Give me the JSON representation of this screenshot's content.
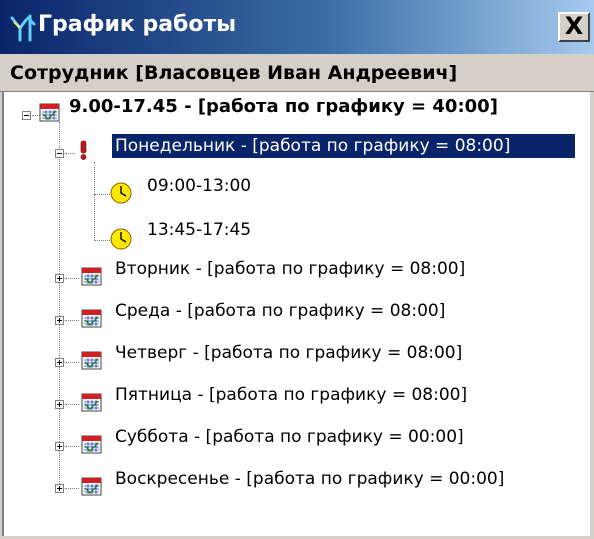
{
  "window": {
    "title": "График работы",
    "close_label": "X",
    "icon": "schedule-app-icon"
  },
  "header": {
    "employee_label": "Сотрудник [Власовцев Иван Андреевич]"
  },
  "tree": {
    "root": {
      "label": "9.00-17.45 - [работа по графику = 40:00]",
      "expanded": true,
      "icon": "calendar-icon"
    },
    "days": [
      {
        "label": "Понедельник - [работа по графику = 08:00]",
        "expanded": true,
        "selected": true,
        "icon": "exclamation-icon",
        "intervals": [
          {
            "label": "09:00-13:00",
            "icon": "clock-icon"
          },
          {
            "label": "13:45-17:45",
            "icon": "clock-icon"
          }
        ]
      },
      {
        "label": "Вторник - [работа по графику = 08:00]",
        "expanded": false,
        "icon": "calendar-icon"
      },
      {
        "label": "Среда - [работа по графику = 08:00]",
        "expanded": false,
        "icon": "calendar-icon"
      },
      {
        "label": "Четверг - [работа по графику = 08:00]",
        "expanded": false,
        "icon": "calendar-icon"
      },
      {
        "label": "Пятница - [работа по графику = 08:00]",
        "expanded": false,
        "icon": "calendar-icon"
      },
      {
        "label": "Суббота - [работа по графику = 00:00]",
        "expanded": false,
        "icon": "calendar-icon"
      },
      {
        "label": "Воскресенье - [работа по графику = 00:00]",
        "expanded": false,
        "icon": "calendar-icon"
      }
    ]
  },
  "colors": {
    "titlebar_start": "#0a246a",
    "titlebar_end": "#a6caf0",
    "selection": "#0a246a",
    "face": "#d4d0c8"
  }
}
